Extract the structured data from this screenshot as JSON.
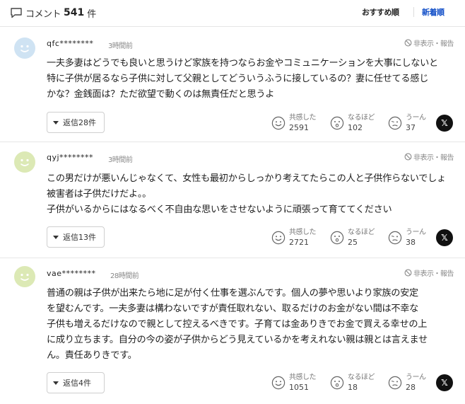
{
  "header": {
    "title": "コメント",
    "count": "541",
    "unit": "件",
    "sort_recommended": "おすすめ順",
    "sort_newest": "新着順"
  },
  "labels": {
    "hide_report": "非表示・報告",
    "empathy": "共感した",
    "insightful": "なるほど",
    "hmm": "うーん",
    "x_glyph": "𝕏"
  },
  "colors": {
    "avatar_blue": "#cfe3f3",
    "avatar_green": "#dce9b5",
    "link_blue": "#0e4cc7"
  },
  "comments": [
    {
      "username": "qfc********",
      "time": "3時間前",
      "avatar": "blue-smiley-avatar",
      "lines": [
        "一夫多妻はどうでも良いと思うけど家族を持つならお金やコミュニケーションを大事にしないと",
        "特に子供が居るなら子供に対して父親としてどういうふうに接しているの？妻に任せてる感じ",
        "かな？金銭面は？ただ欲望で動くのは無責任だと思うよ"
      ],
      "reply_label": "返信28件",
      "empathy_count": "2591",
      "insightful_count": "102",
      "hmm_count": "37"
    },
    {
      "username": "qyj********",
      "time": "3時間前",
      "avatar": "green-smiley-avatar",
      "lines": [
        "この男だけが悪いんじゃなくて、女性も最初からしっかり考えてたらこの人と子供作らないでしょ",
        "被害者は子供だけだよ。。",
        "子供がいるからにはなるべく不自由な思いをさせないように頑張って育ててください"
      ],
      "reply_label": "返信13件",
      "empathy_count": "2721",
      "insightful_count": "25",
      "hmm_count": "38"
    },
    {
      "username": "vae********",
      "time": "28時間前",
      "avatar": "green-smiley-avatar",
      "lines": [
        "普通の親は子供が出来たら地に足が付く仕事を選ぶんです。個人の夢や思いより家族の安定",
        "を望むんです。一夫多妻は構わないですが責任取れない、取るだけのお金がない間は不幸な",
        "子供も増えるだけなので親として控えるべきです。子育ては金ありきでお金で買える幸せの上",
        "に成り立ちます。自分の今の姿が子供からどう見えているかを考えれない親は親とは言えませ",
        "ん。責任ありきです。"
      ],
      "reply_label": "返信4件",
      "empathy_count": "1051",
      "insightful_count": "18",
      "hmm_count": "28"
    }
  ]
}
